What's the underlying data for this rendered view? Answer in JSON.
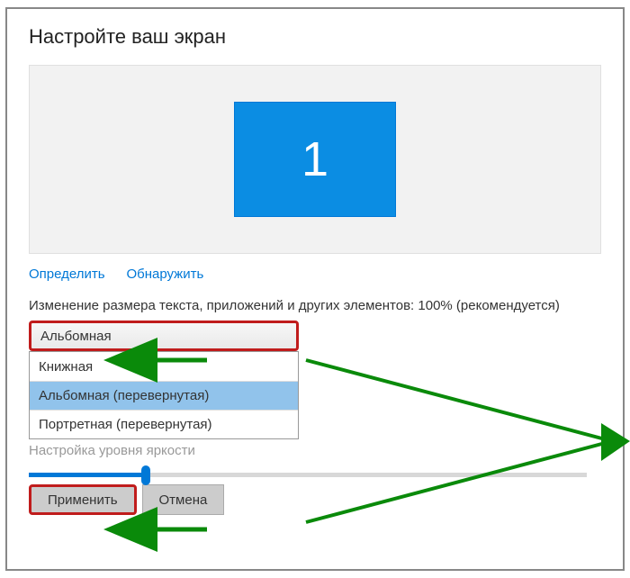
{
  "title": "Настройте ваш экран",
  "monitor_number": "1",
  "links": {
    "identify": "Определить",
    "detect": "Обнаружить"
  },
  "scale_label": "Изменение размера текста, приложений и других элементов: 100% (рекомендуется)",
  "orientation": {
    "selected": "Альбомная",
    "options": [
      "Книжная",
      "Альбомная (перевернутая)",
      "Портретная (перевернутая)"
    ],
    "hover_index": 1
  },
  "brightness_label": "Настройка уровня яркости",
  "buttons": {
    "apply": "Применить",
    "cancel": "Отмена"
  }
}
